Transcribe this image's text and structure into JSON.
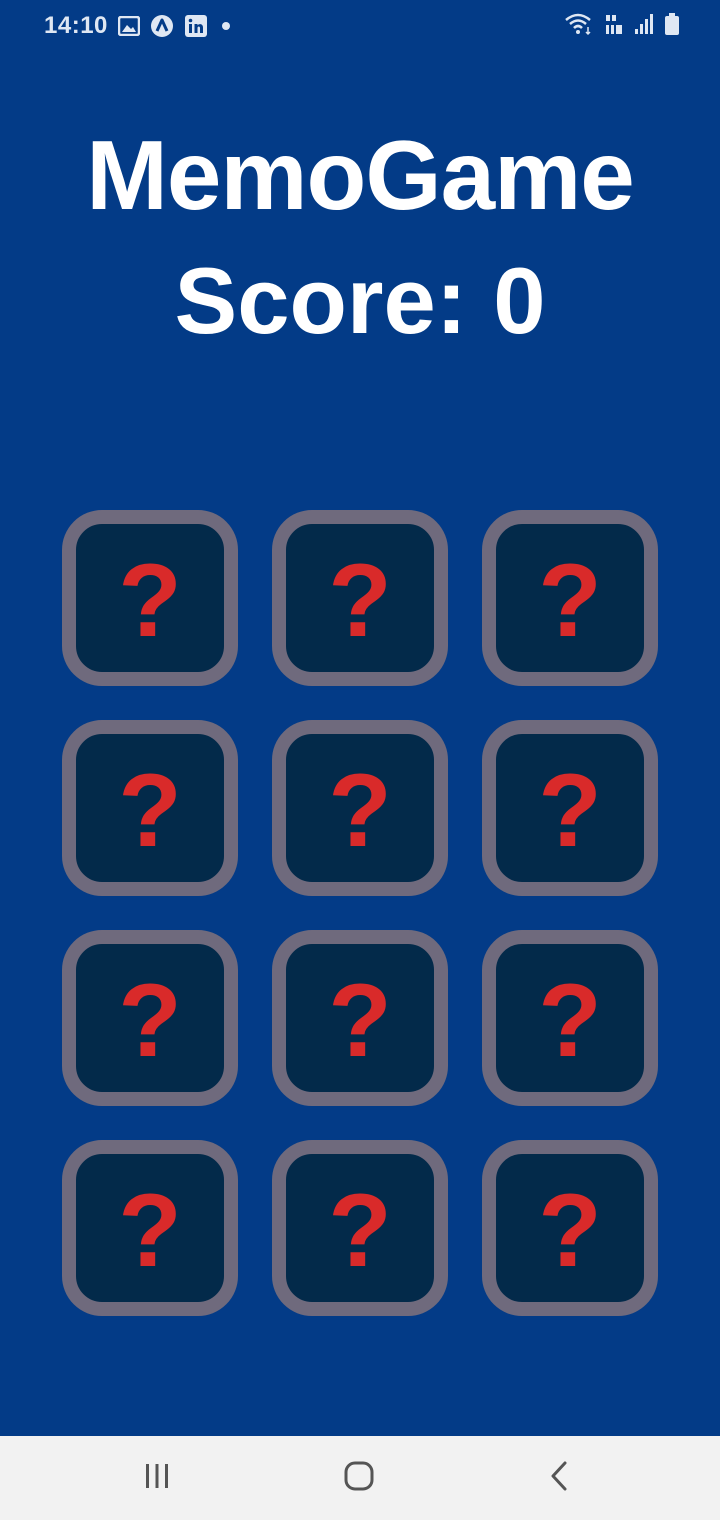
{
  "status_bar": {
    "time": "14:10",
    "notification_icons": [
      "gallery-icon",
      "app-icon",
      "linkedin-icon",
      "dot-icon"
    ],
    "system_icons": [
      "wifi-icon",
      "volte-icon",
      "signal-icon",
      "battery-icon"
    ]
  },
  "game": {
    "title": "MemoGame",
    "score_label": "Score: ",
    "score_value": "0"
  },
  "cards": [
    {
      "symbol": "?"
    },
    {
      "symbol": "?"
    },
    {
      "symbol": "?"
    },
    {
      "symbol": "?"
    },
    {
      "symbol": "?"
    },
    {
      "symbol": "?"
    },
    {
      "symbol": "?"
    },
    {
      "symbol": "?"
    },
    {
      "symbol": "?"
    },
    {
      "symbol": "?"
    },
    {
      "symbol": "?"
    },
    {
      "symbol": "?"
    }
  ],
  "nav_bar": {
    "buttons": [
      "recents-icon",
      "home-icon",
      "back-icon"
    ]
  },
  "colors": {
    "background": "#033b87",
    "card_face": "#032a4a",
    "card_border": "#6f6a7d",
    "symbol": "#d92a2a",
    "nav_bar": "#f2f2f2"
  }
}
